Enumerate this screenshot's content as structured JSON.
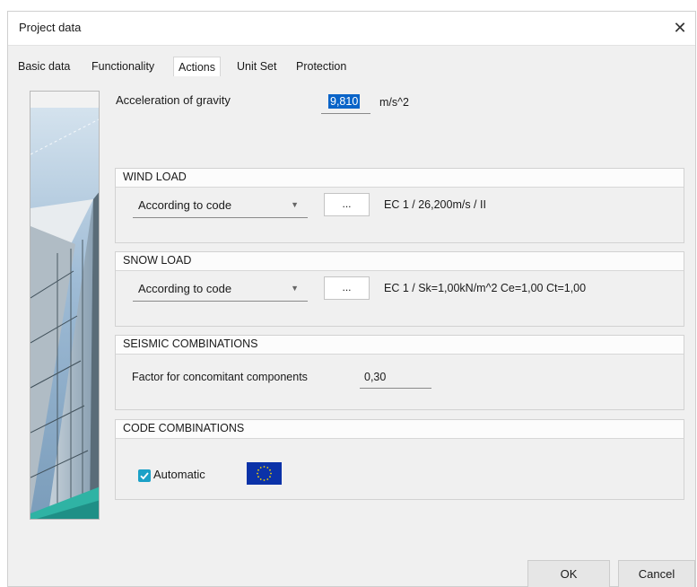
{
  "window": {
    "title": "Project data"
  },
  "tabs": [
    {
      "label": "Basic data"
    },
    {
      "label": "Functionality"
    },
    {
      "label": "Actions"
    },
    {
      "label": "Unit Set"
    },
    {
      "label": "Protection"
    }
  ],
  "active_tab": "Actions",
  "gravity": {
    "label": "Acceleration of gravity",
    "value": "9,810",
    "unit": "m/s^2"
  },
  "wind": {
    "title": "WIND LOAD",
    "method": "According to code",
    "button": "...",
    "description": "EC 1 / 26,200m/s / II"
  },
  "snow": {
    "title": "SNOW LOAD",
    "method": "According to code",
    "button": "...",
    "description": "EC 1 / Sk=1,00kN/m^2 Ce=1,00 Ct=1,00"
  },
  "seismic": {
    "title": "SEISMIC COMBINATIONS",
    "factor_label": "Factor for concomitant components",
    "factor_value": "0,30"
  },
  "code_combinations": {
    "title": "CODE COMBINATIONS",
    "automatic_label": "Automatic",
    "automatic_checked": true,
    "flag_icon": "eu-flag-icon"
  },
  "buttons": {
    "ok": "OK",
    "cancel": "Cancel"
  },
  "colors": {
    "accent": "#0a64c8",
    "checkbox": "#1ba1c7",
    "flag_blue": "#0b32a8",
    "flag_star": "#f5d400"
  }
}
